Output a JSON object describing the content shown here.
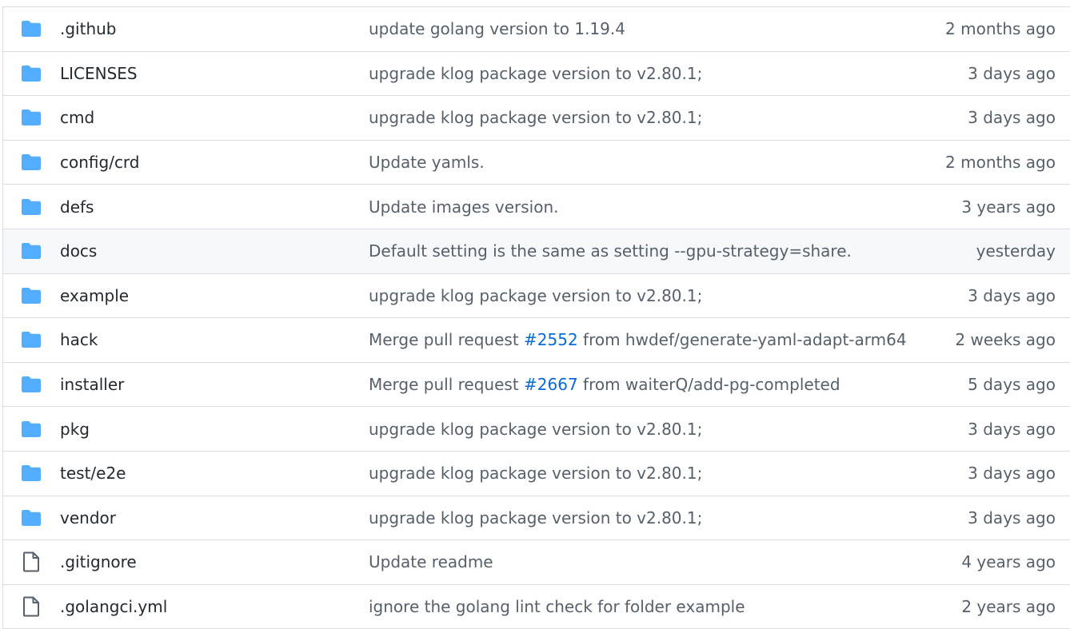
{
  "colors": {
    "folder": "#54aeff",
    "file": "#57606a",
    "link": "#0969da",
    "hover_row": "#f6f8fa",
    "border": "#d8dee4"
  },
  "rows": [
    {
      "icon": "folder-icon",
      "name": ".github",
      "message": "update golang version to 1.19.4",
      "age": "2 months ago"
    },
    {
      "icon": "folder-icon",
      "name": "LICENSES",
      "message": "upgrade klog package version to v2.80.1;",
      "age": "3 days ago"
    },
    {
      "icon": "folder-icon",
      "name": "cmd",
      "message": "upgrade klog package version to v2.80.1;",
      "age": "3 days ago"
    },
    {
      "icon": "folder-icon",
      "name": "config/crd",
      "message": "Update yamls.",
      "age": "2 months ago"
    },
    {
      "icon": "folder-icon",
      "name": "defs",
      "message": "Update images version.",
      "age": "3 years ago"
    },
    {
      "icon": "folder-icon",
      "name": "docs",
      "message": "Default setting is the same as setting --gpu-strategy=share.",
      "age": "yesterday",
      "hover": true
    },
    {
      "icon": "folder-icon",
      "name": "example",
      "message": "upgrade klog package version to v2.80.1;",
      "age": "3 days ago"
    },
    {
      "icon": "folder-icon",
      "name": "hack",
      "message_prefix": "Merge pull request ",
      "message_link": "#2552",
      "message_suffix": " from hwdef/generate-yaml-adapt-arm64",
      "age": "2 weeks ago"
    },
    {
      "icon": "folder-icon",
      "name": "installer",
      "message_prefix": "Merge pull request ",
      "message_link": "#2667",
      "message_suffix": " from waiterQ/add-pg-completed",
      "age": "5 days ago"
    },
    {
      "icon": "folder-icon",
      "name": "pkg",
      "message": "upgrade klog package version to v2.80.1;",
      "age": "3 days ago"
    },
    {
      "icon": "folder-icon",
      "name": "test/e2e",
      "message": "upgrade klog package version to v2.80.1;",
      "age": "3 days ago"
    },
    {
      "icon": "folder-icon",
      "name": "vendor",
      "message": "upgrade klog package version to v2.80.1;",
      "age": "3 days ago"
    },
    {
      "icon": "file-icon",
      "name": ".gitignore",
      "message": "Update readme",
      "age": "4 years ago"
    },
    {
      "icon": "file-icon",
      "name": ".golangci.yml",
      "message": "ignore the golang lint check for folder example",
      "age": "2 years ago"
    }
  ]
}
